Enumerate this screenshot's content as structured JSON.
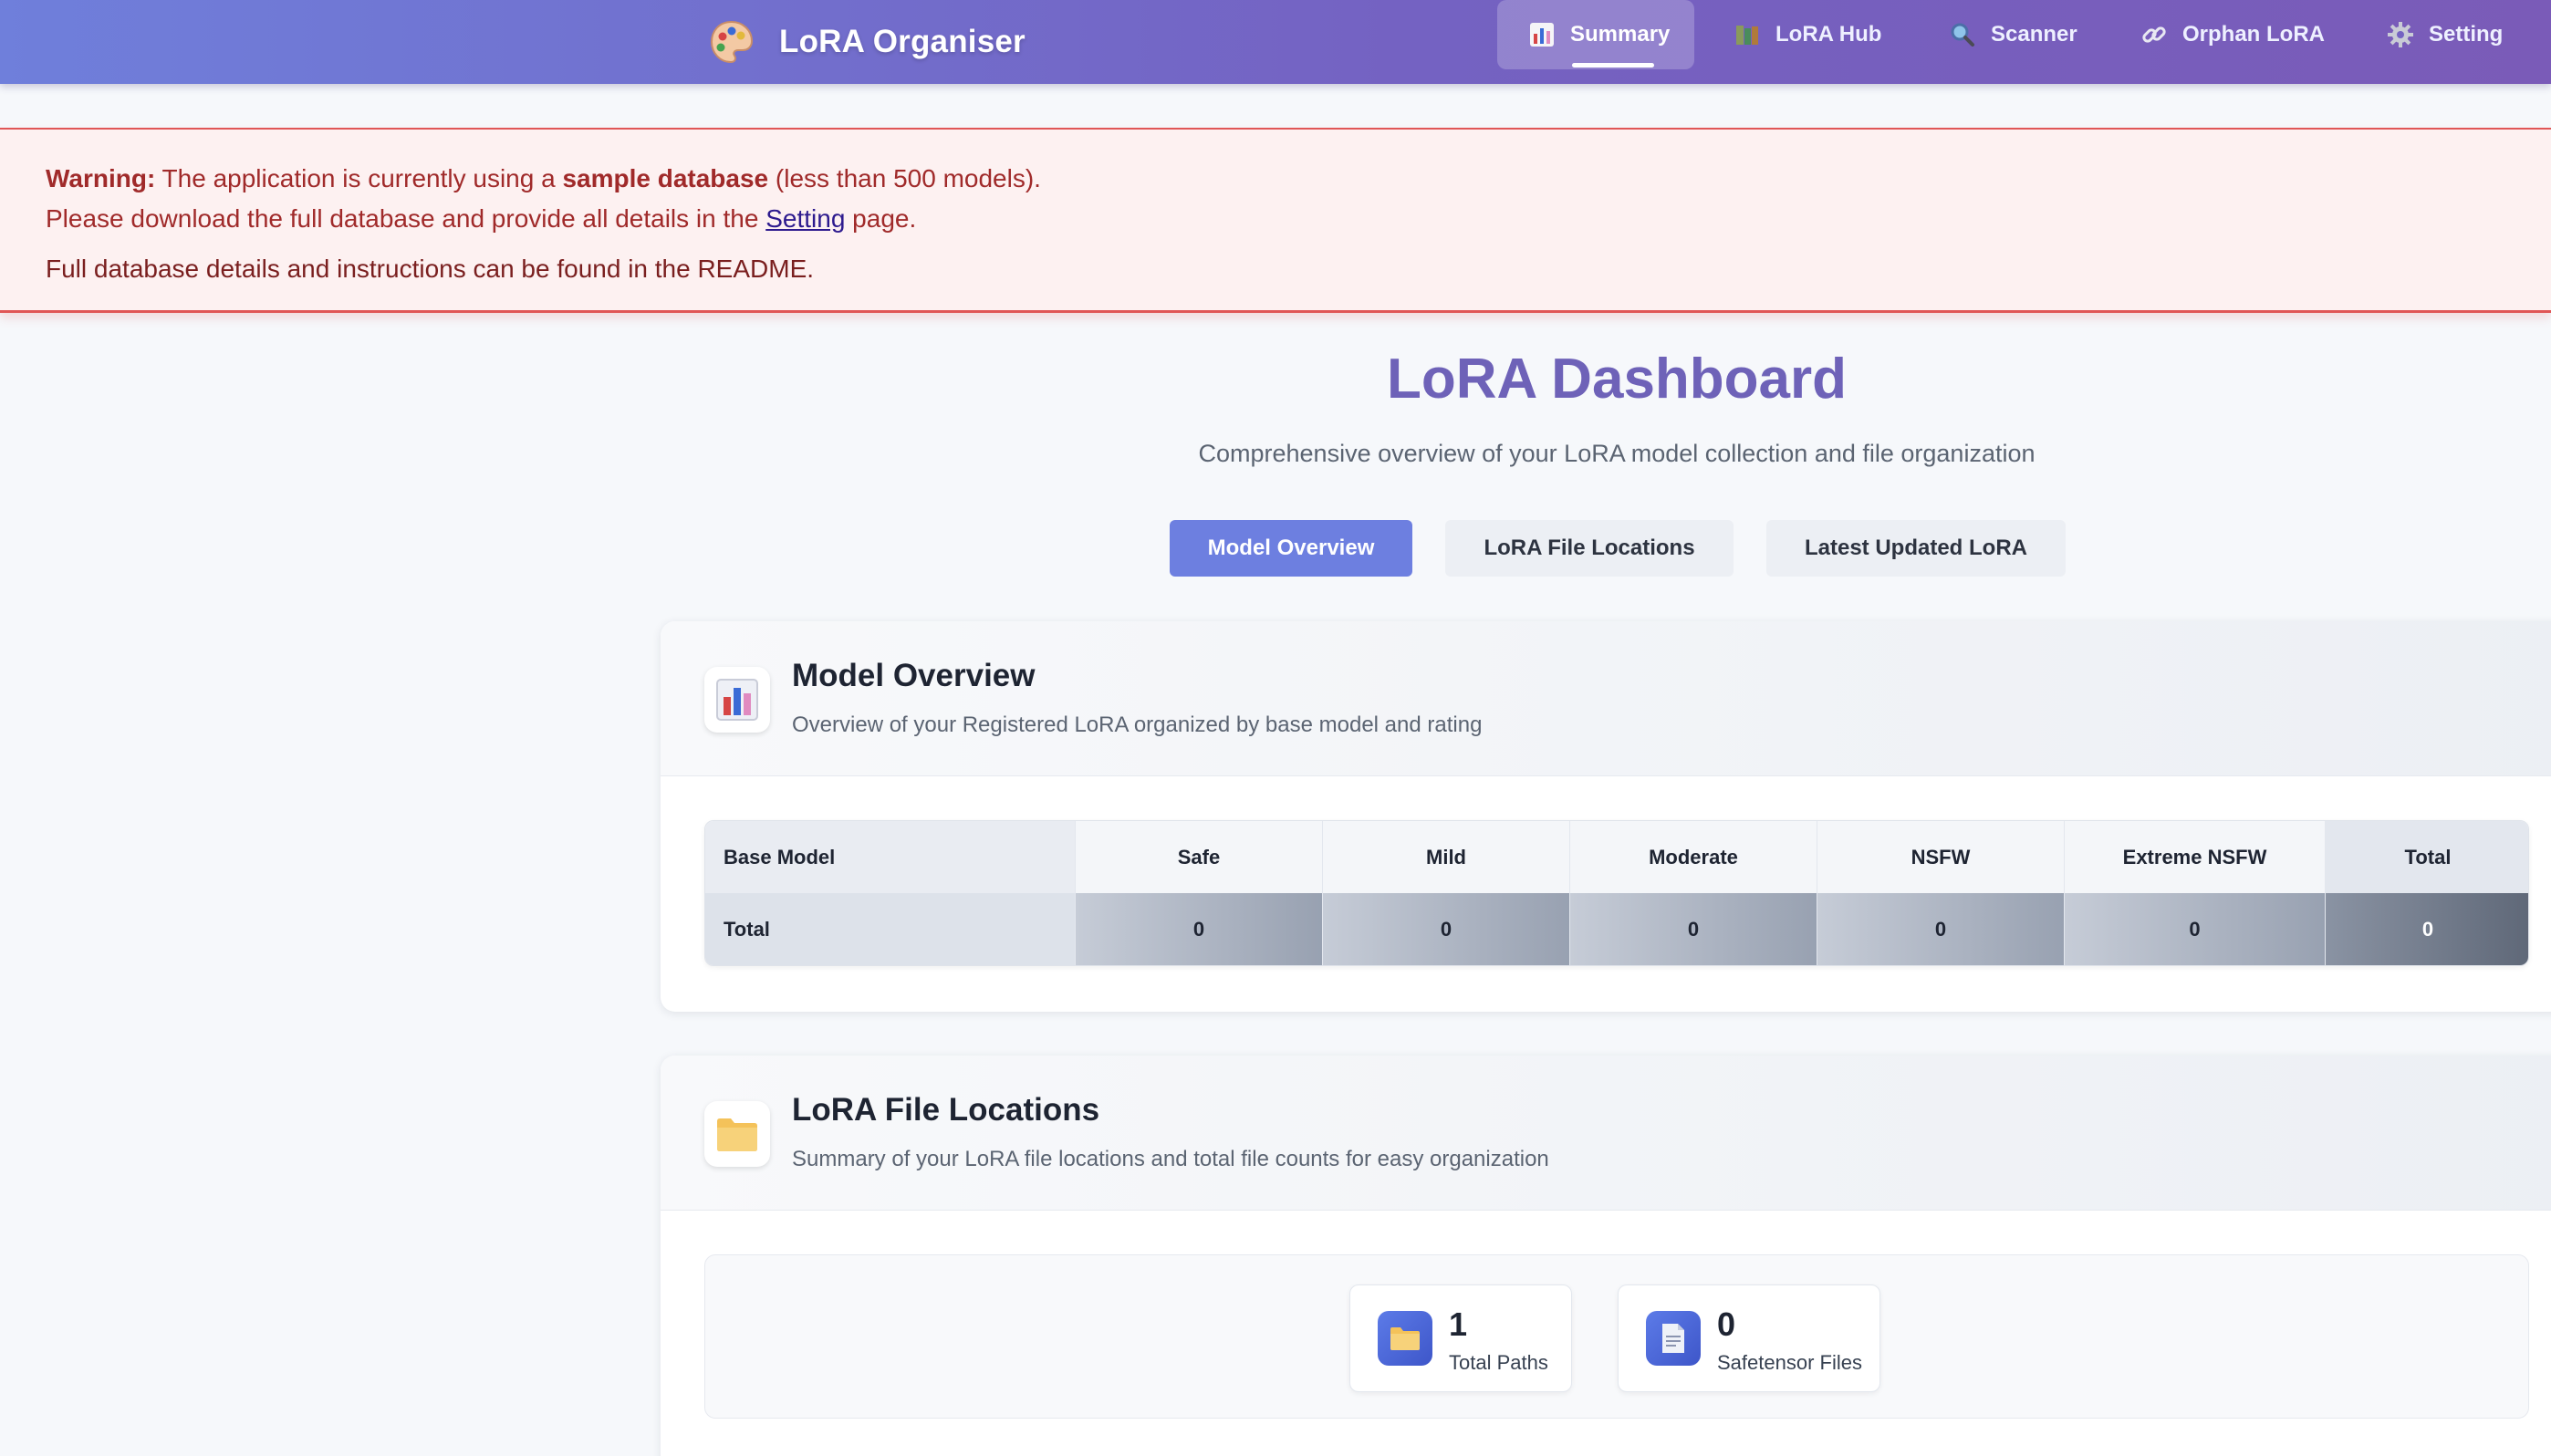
{
  "app": {
    "title": "LoRA Organiser",
    "logo_icon": "palette-icon"
  },
  "nav": {
    "items": [
      {
        "label": "Summary",
        "icon": "bar-chart-icon",
        "active": true
      },
      {
        "label": "LoRA Hub",
        "icon": "books-icon",
        "active": false
      },
      {
        "label": "Scanner",
        "icon": "magnifier-icon",
        "active": false
      },
      {
        "label": "Orphan LoRA",
        "icon": "link-icon",
        "active": false
      },
      {
        "label": "Setting",
        "icon": "gear-icon",
        "active": false
      }
    ]
  },
  "warning": {
    "label": "Warning:",
    "text_1": " The application is currently using a ",
    "emph": "sample database",
    "text_2": " (less than 500 models).",
    "line2_pre": "Please download the full database and provide all details in the ",
    "line2_link": "Setting",
    "line2_post": " page.",
    "line3": "Full database details and instructions can be found in the README.",
    "color": "#e05656"
  },
  "page": {
    "title": "LoRA Dashboard",
    "subtitle": "Comprehensive overview of your LoRA model collection and file organization"
  },
  "tabs": [
    {
      "label": "Model Overview",
      "active": true
    },
    {
      "label": "LoRA File Locations",
      "active": false
    },
    {
      "label": "Latest Updated LoRA",
      "active": false
    }
  ],
  "overview": {
    "icon": "bar-chart-icon",
    "title": "Model Overview",
    "description": "Overview of your Registered LoRA organized by base model and rating",
    "table": {
      "headers": [
        "Base Model",
        "Safe",
        "Mild",
        "Moderate",
        "NSFW",
        "Extreme NSFW",
        "Total"
      ],
      "total_row": [
        "Total",
        "0",
        "0",
        "0",
        "0",
        "0",
        "0"
      ]
    }
  },
  "locations": {
    "icon": "folder-icon",
    "title": "LoRA File Locations",
    "description": "Summary of your LoRA file locations and total file counts for easy organization",
    "stats": [
      {
        "value": "1",
        "label": "Total Paths",
        "icon": "folder-icon"
      },
      {
        "value": "0",
        "label": "Safetensor Files",
        "icon": "document-icon"
      }
    ]
  },
  "colors": {
    "accent": "#6d7fe0",
    "title": "#6e62b8",
    "nav_start": "#6f7fdb",
    "nav_end": "#7a5bb8"
  }
}
